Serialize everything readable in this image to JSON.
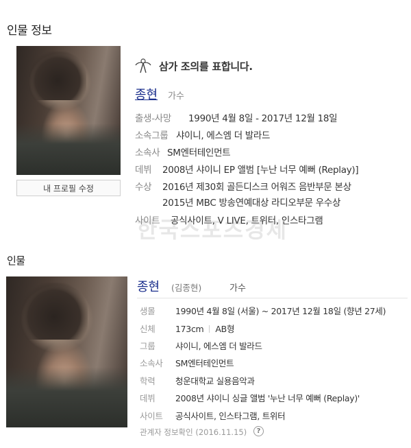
{
  "section1": {
    "title": "인물 정보",
    "edit_button": "내 프로필 수정",
    "mourning": "삼가 조의를 표합니다.",
    "name": "종현",
    "occupation": "가수",
    "rows": [
      {
        "label": "출생-사망",
        "value": "1990년 4월 8일 - 2017년 12월 18일"
      },
      {
        "label": "소속그룹",
        "value": "샤이니, 에스엠 더 발라드"
      },
      {
        "label": "소속사",
        "value": "SM엔터테인먼트"
      },
      {
        "label": "데뷔",
        "value": "2008년 샤이니 EP 앨범 [누난 너무 예뻐 (Replay)]"
      },
      {
        "label": "수상",
        "value": "2016년 제30회 골든디스크 어워즈 음반부문 본상",
        "value2": "2015년 MBC 방송연예대상 라디오부문 우수상"
      },
      {
        "label": "사이트",
        "value": "공식사이트, V LIVE, 트위터, 인스타그램"
      }
    ],
    "watermark": "한국스포츠경제"
  },
  "section2": {
    "title": "인물",
    "name": "종현",
    "full_name": "(김종현)",
    "occupation": "가수",
    "rows": [
      {
        "label": "생몰",
        "value": "1990년 4월 8일 (서울) ~ 2017년 12월 18일 (향년 27세)"
      },
      {
        "label": "신체",
        "value": "173cm",
        "value2": "AB형"
      },
      {
        "label": "그룹",
        "value": "샤이니, 에스엠 더 발라드"
      },
      {
        "label": "소속사",
        "value": "SM엔터테인먼트"
      },
      {
        "label": "학력",
        "value": "청운대학교 실용음악과"
      },
      {
        "label": "데뷔",
        "value": "2008년 샤이니 싱글 앨범 '누난 너무 예뻐 (Replay)'"
      },
      {
        "label": "사이트",
        "value": "공식사이트, 인스타그램, 트위터"
      }
    ],
    "verify": "관계자 정보확인 (2016.11.15)",
    "help": "?"
  },
  "colors": {
    "link": "#1a2e8c",
    "label": "#888888",
    "text": "#333333"
  }
}
